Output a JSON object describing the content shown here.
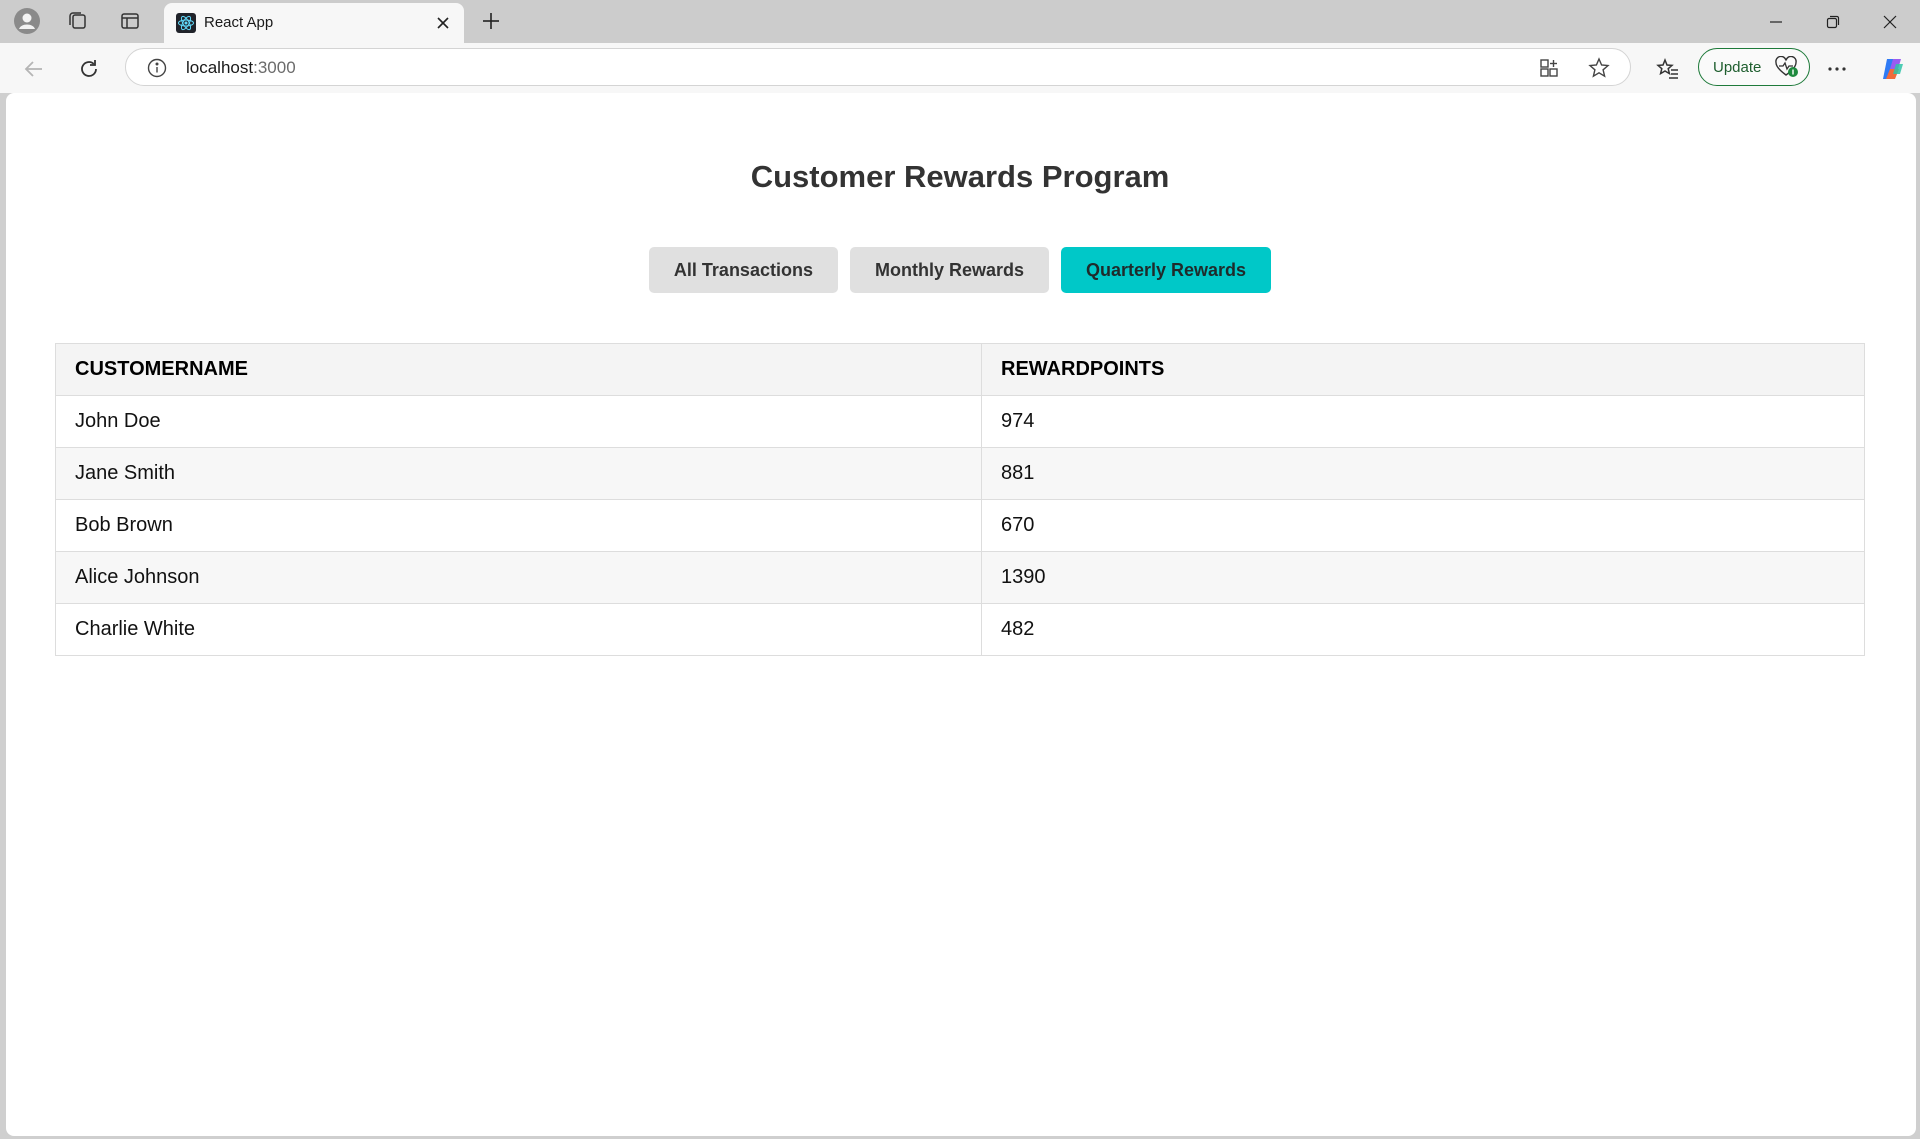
{
  "browser": {
    "tab": {
      "title": "React App"
    },
    "address": {
      "host": "localhost",
      "port": ":3000"
    },
    "update_label": "Update"
  },
  "page": {
    "title": "Customer Rewards Program",
    "buttons": [
      {
        "label": "All Transactions",
        "active": false
      },
      {
        "label": "Monthly Rewards",
        "active": false
      },
      {
        "label": "Quarterly Rewards",
        "active": true
      }
    ],
    "table": {
      "headers": [
        "CUSTOMERNAME",
        "REWARDPOINTS"
      ],
      "rows": [
        [
          "John Doe",
          "974"
        ],
        [
          "Jane Smith",
          "881"
        ],
        [
          "Bob Brown",
          "670"
        ],
        [
          "Alice Johnson",
          "1390"
        ],
        [
          "Charlie White",
          "482"
        ]
      ]
    }
  },
  "colors": {
    "active_button": "#00c8c8",
    "update_border": "#1e7a3a"
  },
  "icons": [
    "profile-icon",
    "workspaces-icon",
    "vertical-tabs-icon",
    "react-favicon-icon",
    "close-tab-icon",
    "new-tab-icon",
    "minimize-icon",
    "restore-icon",
    "close-window-icon",
    "back-icon",
    "refresh-icon",
    "site-info-icon",
    "app-available-icon",
    "favorite-star-icon",
    "favorites-icon",
    "health-check-icon",
    "more-options-icon",
    "copilot-icon"
  ]
}
